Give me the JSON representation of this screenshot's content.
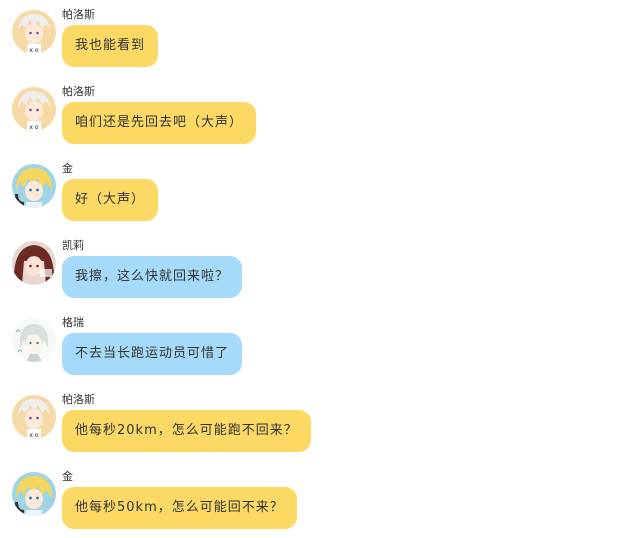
{
  "colors": {
    "bubble_yellow": "#fcd865",
    "bubble_blue": "#a6dafa",
    "background": "#ffffff"
  },
  "messages": [
    {
      "sender": "帕洛斯",
      "text": "我也能看到",
      "bubble": "yellow",
      "avatar": "palos-avatar"
    },
    {
      "sender": "帕洛斯",
      "text": "咱们还是先回去吧（大声）",
      "bubble": "yellow",
      "avatar": "palos-avatar"
    },
    {
      "sender": "金",
      "text": "好（大声）",
      "bubble": "yellow",
      "avatar": "jin-avatar"
    },
    {
      "sender": "凯莉",
      "text": "我擦，这么快就回来啦？",
      "bubble": "blue",
      "avatar": "kaili-avatar"
    },
    {
      "sender": "格瑞",
      "text": "不去当长跑运动员可惜了",
      "bubble": "blue",
      "avatar": "gerui-avatar"
    },
    {
      "sender": "帕洛斯",
      "text": "他每秒20km，怎么可能跑不回来？",
      "bubble": "yellow",
      "avatar": "palos-avatar"
    },
    {
      "sender": "金",
      "text": "他每秒50km，怎么可能回不来？",
      "bubble": "yellow",
      "avatar": "jin-avatar"
    }
  ]
}
